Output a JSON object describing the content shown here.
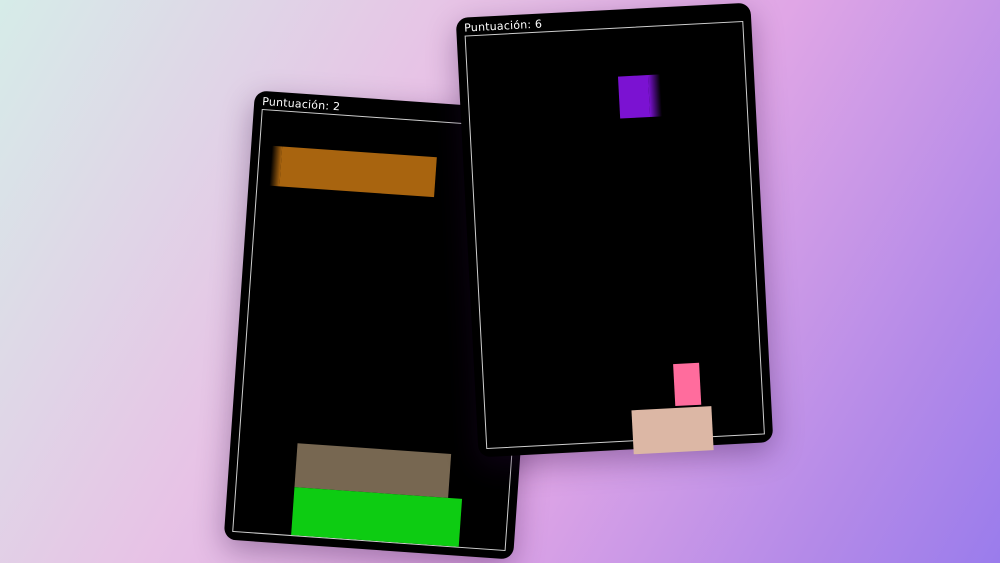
{
  "background": {
    "gradient": [
      "#d6ece8",
      "#e7c3e6",
      "#e0a6e6",
      "#b48ae8",
      "#9a7cec"
    ]
  },
  "games": [
    {
      "score_text": "Puntuación: 2",
      "moving_block": {
        "color": "#a8640f"
      },
      "stack": [
        {
          "color": "#776751"
        },
        {
          "color": "#0dcc12"
        }
      ]
    },
    {
      "score_text": "Puntuación: 6",
      "moving_block": {
        "color": "#7b12d2"
      },
      "stack": [
        {
          "color": "#dcb7a5"
        },
        {
          "color": "#ff6c9d"
        }
      ]
    }
  ]
}
